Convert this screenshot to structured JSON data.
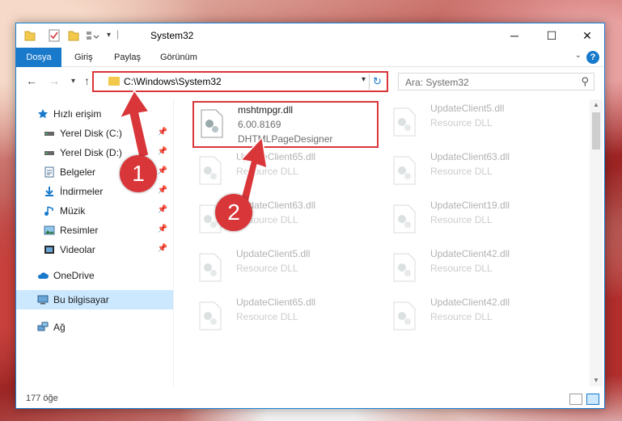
{
  "window": {
    "title": "System32"
  },
  "ribbon": {
    "tabs": [
      "Dosya",
      "Giriş",
      "Paylaş",
      "Görünüm"
    ],
    "help": "?"
  },
  "address": {
    "path": "C:\\Windows\\System32"
  },
  "search": {
    "placeholder": "Ara: System32"
  },
  "sidebar": {
    "items": [
      {
        "label": "Hızlı erişim",
        "icon": "star-icon"
      },
      {
        "label": "Yerel Disk (C:)",
        "icon": "drive-icon",
        "pinned": true
      },
      {
        "label": "Yerel Disk (D:)",
        "icon": "drive-icon",
        "pinned": true
      },
      {
        "label": "Belgeler",
        "icon": "document-icon",
        "pinned": true
      },
      {
        "label": "İndirmeler",
        "icon": "download-icon",
        "pinned": true
      },
      {
        "label": "Müzik",
        "icon": "music-icon",
        "pinned": true
      },
      {
        "label": "Resimler",
        "icon": "pictures-icon",
        "pinned": true
      },
      {
        "label": "Videolar",
        "icon": "video-icon",
        "pinned": true
      },
      {
        "label": "OneDrive",
        "icon": "cloud-icon"
      },
      {
        "label": "Bu bilgisayar",
        "icon": "computer-icon",
        "selected": true
      },
      {
        "label": "Ağ",
        "icon": "network-icon"
      }
    ]
  },
  "files": [
    {
      "name": "mshtmpgr.dll",
      "line1": "6.00.8169",
      "line2": "DHTMLPageDesigner",
      "highlighted": true
    },
    {
      "name": "UpdateClient5.dll",
      "line1": "Resource DLL"
    },
    {
      "name": "UpdateClient65.dll",
      "line1": "Resource DLL"
    },
    {
      "name": "UpdateClient63.dll",
      "line1": "Resource DLL"
    },
    {
      "name": "UpdateClient63.dll",
      "line1": "Resource DLL"
    },
    {
      "name": "UpdateClient19.dll",
      "line1": "Resource DLL"
    },
    {
      "name": "UpdateClient5.dll",
      "line1": "Resource DLL"
    },
    {
      "name": "UpdateClient42.dll",
      "line1": "Resource DLL"
    },
    {
      "name": "UpdateClient65.dll",
      "line1": "Resource DLL"
    },
    {
      "name": "UpdateClient42.dll",
      "line1": "Resource DLL"
    }
  ],
  "status": {
    "count": "177 öğe"
  },
  "annotations": {
    "badge1": "1",
    "badge2": "2"
  },
  "colors": {
    "accent": "#1979ca",
    "annotation": "#d9363a",
    "selection": "#cce8ff"
  }
}
